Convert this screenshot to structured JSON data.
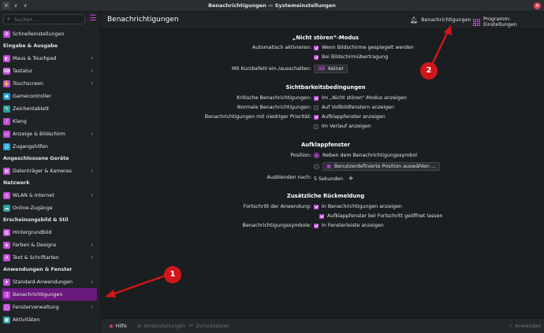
{
  "window": {
    "title": "Benachrichtigungen — Systemeinstellungen"
  },
  "sidebar": {
    "search_placeholder": "Suchen ...",
    "entries": [
      {
        "type": "item",
        "label": "Schnelleinstellungen",
        "icon": "quick-settings-icon",
        "color": "#c04cd6",
        "chev": false
      },
      {
        "type": "cat",
        "label": "Eingabe & Ausgabe"
      },
      {
        "type": "item",
        "label": "Maus & Touchpad",
        "icon": "mouse-icon",
        "color": "#c04cd6",
        "chev": true
      },
      {
        "type": "item",
        "label": "Tastatur",
        "icon": "keyboard-icon",
        "color": "#c04cd6",
        "chev": true
      },
      {
        "type": "item",
        "label": "Touchscreen",
        "icon": "touchscreen-icon",
        "color": "#c04cd6",
        "chev": true
      },
      {
        "type": "item",
        "label": "Gamecontroller",
        "icon": "gamepad-icon",
        "color": "#1e9fd6",
        "chev": false
      },
      {
        "type": "item",
        "label": "Zeichentablett",
        "icon": "tablet-icon",
        "color": "#2aa198",
        "chev": false
      },
      {
        "type": "item",
        "label": "Klang",
        "icon": "speaker-icon",
        "color": "#c04cd6",
        "chev": false
      },
      {
        "type": "item",
        "label": "Anzeige & Bildschirm",
        "icon": "display-icon",
        "color": "#c04cd6",
        "chev": true
      },
      {
        "type": "item",
        "label": "Zugangshilfen",
        "icon": "accessibility-icon",
        "color": "#1e9fd6",
        "chev": false
      },
      {
        "type": "cat",
        "label": "Angeschlossene Geräte"
      },
      {
        "type": "item",
        "label": "Datenträger & Kameras",
        "icon": "drive-icon",
        "color": "#c04cd6",
        "chev": true
      },
      {
        "type": "cat",
        "label": "Netzwerk"
      },
      {
        "type": "item",
        "label": "WLAN & Internet",
        "icon": "network-icon",
        "color": "#c04cd6",
        "chev": true
      },
      {
        "type": "item",
        "label": "Online-Zugänge",
        "icon": "online-accounts-icon",
        "color": "#2aa198",
        "chev": false
      },
      {
        "type": "cat",
        "label": "Erscheinungsbild & Stil"
      },
      {
        "type": "item",
        "label": "Hintergrundbild",
        "icon": "wallpaper-icon",
        "color": "#c04cd6",
        "chev": false
      },
      {
        "type": "item",
        "label": "Farben & Designs",
        "icon": "palette-icon",
        "color": "#c04cd6",
        "chev": true
      },
      {
        "type": "item",
        "label": "Text & Schriftarten",
        "icon": "font-icon",
        "color": "#c04cd6",
        "chev": true
      },
      {
        "type": "cat",
        "label": "Anwendungen & Fenster"
      },
      {
        "type": "item",
        "label": "Standard-Anwendungen",
        "icon": "default-apps-icon",
        "color": "#c04cd6",
        "chev": true
      },
      {
        "type": "item",
        "label": "Benachrichtigungen",
        "icon": "bell-icon",
        "color": "#c04cd6",
        "chev": false,
        "selected": true
      },
      {
        "type": "item",
        "label": "Fensterverwaltung",
        "icon": "window-icon",
        "color": "#c04cd6",
        "chev": true
      },
      {
        "type": "item",
        "label": "Aktivitäten",
        "icon": "activities-icon",
        "color": "#2aa198",
        "chev": false
      }
    ]
  },
  "header": {
    "title": "Benachrichtigungen",
    "notifications_button": "Benachrichtigungen",
    "program_settings_button": "Programm-Einstellungen"
  },
  "dnd": {
    "title": "„Nicht stören“-Modus",
    "auto_label": "Automatisch aktivieren:",
    "opt_mirrored": "Wenn Bildschirme gespiegelt werden",
    "opt_screenshare": "Bei Bildschirmübertragung",
    "shortcut_label": "Mit Kurzbefehl ein-/ausschalten:",
    "shortcut_value": "Keiner"
  },
  "visibility": {
    "title": "Sichtbarkeitsbedingungen",
    "critical_label": "Kritische Benachrichtigungen:",
    "critical_value": "Im „Nicht stören“-Modus anzeigen",
    "normal_label": "Normale Benachrichtigungen:",
    "normal_value": "Auf Vollbildfenstern anzeigen",
    "low_label": "Benachrichtigungen mit niedriger Priorität:",
    "low_popup": "Aufklappfenster anzeigen",
    "low_history": "Im Verlauf anzeigen"
  },
  "popup": {
    "title": "Aufklappfenster",
    "position_label": "Position:",
    "position_default": "Neben dem Benachrichtigungssymbol",
    "position_custom": "Benutzerdefinierte Position auswählen ...",
    "hide_label": "Ausblenden nach:",
    "hide_value": "5 Sekunden"
  },
  "feedback": {
    "title": "Zusätzliche Rückmeldung",
    "progress_label": "Fortschritt der Anwendung:",
    "progress_value": "In Benachrichtigungen anzeigen",
    "progress_keep": "Aufklappfenster bei Fortschritt geöffnet lassen",
    "badges_label": "Benachrichtigungssymbole:",
    "badges_value": "In Fensterleiste anzeigen"
  },
  "footer": {
    "help": "Hilfe",
    "defaults": "Voreinstellungen",
    "reset": "Zurücksetzen",
    "apply": "Anwenden"
  },
  "annotations": {
    "one": "1",
    "two": "2"
  },
  "colors": {
    "accent": "#c04cd6",
    "selected": "#6a1a7c",
    "annotation": "#d0161b"
  }
}
